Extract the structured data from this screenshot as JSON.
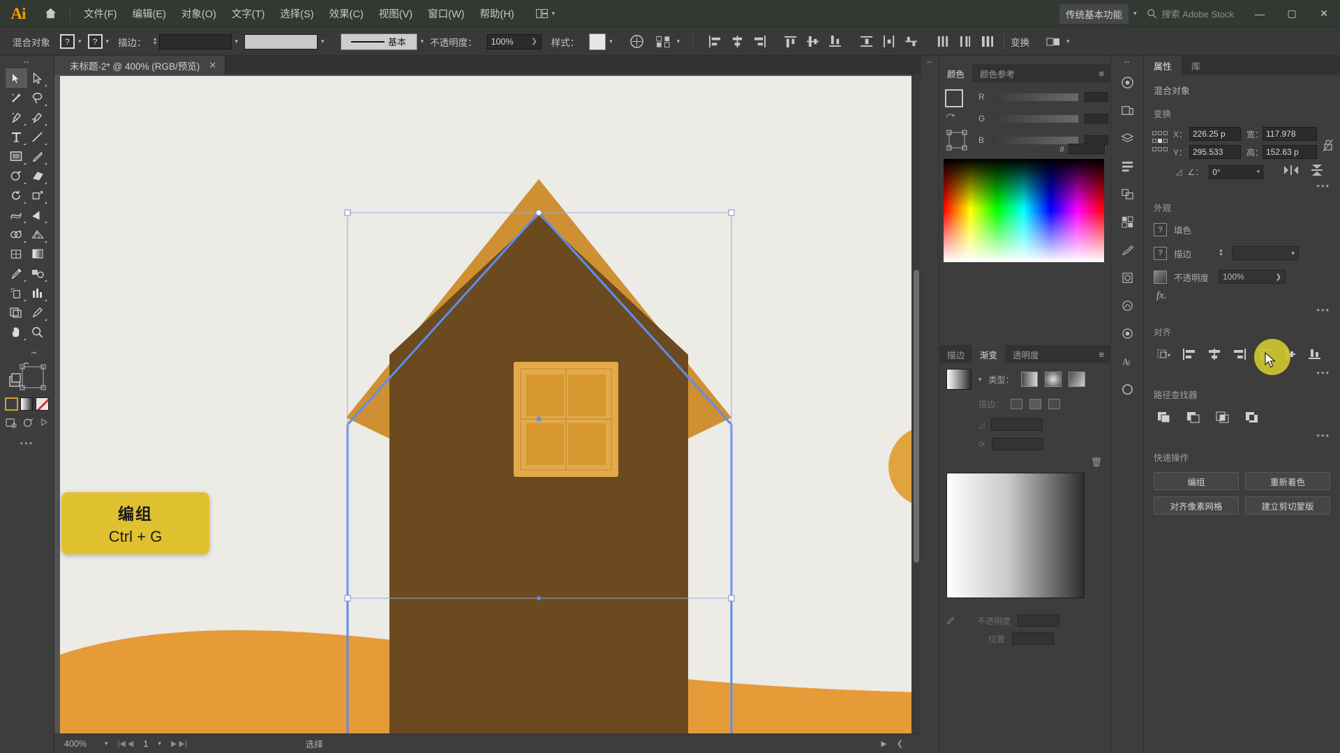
{
  "app": {
    "name": "Adobe Illustrator",
    "logo_text": "Ai"
  },
  "menubar": {
    "items": [
      {
        "label": "文件(F)"
      },
      {
        "label": "编辑(E)"
      },
      {
        "label": "对象(O)"
      },
      {
        "label": "文字(T)"
      },
      {
        "label": "选择(S)"
      },
      {
        "label": "效果(C)"
      },
      {
        "label": "视图(V)"
      },
      {
        "label": "窗口(W)"
      },
      {
        "label": "帮助(H)"
      }
    ],
    "workspace": "传统基本功能",
    "search_placeholder": "搜索 Adobe Stock",
    "window_controls": {
      "minimize": "—",
      "maximize": "▢",
      "close": "✕"
    }
  },
  "controlbar": {
    "object_label": "混合对象",
    "fill_value": "?",
    "stroke_value": "?",
    "stroke_label": "描边：",
    "stroke_weight": "",
    "brush_label": "基本",
    "opacity_label": "不透明度：",
    "opacity_value": "100%",
    "style_label": "样式：",
    "transform_label": "变换"
  },
  "toolbar": {
    "tools": [
      {
        "name": "selection-tool",
        "glyph": "selection",
        "selected": true
      },
      {
        "name": "direct-selection-tool",
        "glyph": "direct-selection",
        "selected": false
      },
      {
        "name": "magic-wand-tool",
        "glyph": "magic-wand",
        "selected": false
      },
      {
        "name": "lasso-tool",
        "glyph": "lasso",
        "selected": false
      },
      {
        "name": "pen-tool",
        "glyph": "pen",
        "selected": false
      },
      {
        "name": "curvature-tool",
        "glyph": "curvature",
        "selected": false
      },
      {
        "name": "type-tool",
        "glyph": "type",
        "selected": false
      },
      {
        "name": "line-segment-tool",
        "glyph": "line",
        "selected": false
      },
      {
        "name": "rectangle-tool",
        "glyph": "rectangle",
        "selected": false
      },
      {
        "name": "paintbrush-tool",
        "glyph": "paintbrush",
        "selected": false
      },
      {
        "name": "shaper-tool",
        "glyph": "shaper",
        "selected": false
      },
      {
        "name": "eraser-tool",
        "glyph": "eraser",
        "selected": false
      },
      {
        "name": "rotate-tool",
        "glyph": "rotate",
        "selected": false
      },
      {
        "name": "scale-tool",
        "glyph": "scale",
        "selected": false
      },
      {
        "name": "width-tool",
        "glyph": "width",
        "selected": false
      },
      {
        "name": "free-transform-tool",
        "glyph": "free-transform",
        "selected": false
      },
      {
        "name": "shape-builder-tool",
        "glyph": "shape-builder",
        "selected": false
      },
      {
        "name": "perspective-grid-tool",
        "glyph": "perspective",
        "selected": false
      },
      {
        "name": "mesh-tool",
        "glyph": "mesh",
        "selected": false
      },
      {
        "name": "gradient-tool",
        "glyph": "gradient",
        "selected": false
      },
      {
        "name": "eyedropper-tool",
        "glyph": "eyedropper",
        "selected": false
      },
      {
        "name": "blend-tool",
        "glyph": "blend",
        "selected": false
      },
      {
        "name": "symbol-sprayer-tool",
        "glyph": "symbol-sprayer",
        "selected": false
      },
      {
        "name": "column-graph-tool",
        "glyph": "column-graph",
        "selected": false
      },
      {
        "name": "artboard-tool",
        "glyph": "artboard",
        "selected": false
      },
      {
        "name": "slice-tool",
        "glyph": "slice",
        "selected": false
      },
      {
        "name": "hand-tool",
        "glyph": "hand",
        "selected": false
      },
      {
        "name": "zoom-tool",
        "glyph": "zoom",
        "selected": false
      }
    ],
    "color_controls": [
      "fill-swatch",
      "gradient-swatch",
      "none-swatch"
    ]
  },
  "document": {
    "tab_title": "未标题-2* @ 400% (RGB/预览)",
    "close_label": "✕"
  },
  "statusbar": {
    "zoom": "400%",
    "page": "1",
    "tool": "选择"
  },
  "color_panel": {
    "tabs": [
      {
        "label": "颜色",
        "active": true
      },
      {
        "label": "颜色参考",
        "active": false
      }
    ],
    "channels": [
      {
        "label": "R",
        "value": ""
      },
      {
        "label": "G",
        "value": ""
      },
      {
        "label": "B",
        "value": ""
      }
    ],
    "hex_label": "#",
    "hex_value": ""
  },
  "gradient_panel": {
    "tabs": [
      {
        "label": "描边",
        "active": false
      },
      {
        "label": "渐变",
        "active": true
      },
      {
        "label": "透明度",
        "active": false
      }
    ],
    "type_label": "类型：",
    "stroke_label": "描边：",
    "angle_label": "",
    "opacity_label": "不透明度",
    "location_label": "位置"
  },
  "properties": {
    "tabs": [
      {
        "label": "属性",
        "active": true
      },
      {
        "label": "库",
        "active": false
      }
    ],
    "object_type": "混合对象",
    "transform": {
      "title": "变换",
      "x_label": "X：",
      "x_value": "226.25 p",
      "y_label": "Y：",
      "y_value": "295.533",
      "w_label": "宽：",
      "w_value": "117.978",
      "h_label": "高：",
      "h_value": "152.63 p",
      "angle_label": "∠：",
      "angle_value": "0°"
    },
    "appearance": {
      "title": "外观",
      "fill_label": "填色",
      "stroke_label": "描边",
      "opacity_label": "不透明度",
      "opacity_value": "100%",
      "fx_label": "fx."
    },
    "align": {
      "title": "对齐"
    },
    "pathfinder": {
      "title": "路径查找器"
    },
    "quick_actions": {
      "title": "快速操作",
      "buttons": [
        {
          "label": "编组"
        },
        {
          "label": "重新着色"
        },
        {
          "label": "对齐像素网格"
        },
        {
          "label": "建立剪切蒙版"
        }
      ]
    }
  },
  "callout": {
    "line1": "编组",
    "line2": "Ctrl + G",
    "bg_color": "#e0c230"
  },
  "artwork": {
    "colors": {
      "wall": "#6b4a1f",
      "roof": "#cf9033",
      "window_frame": "#e3a94a",
      "window_pane": "#d6982f",
      "ground": "#e49b38",
      "artboard_bg": "#ecebe6",
      "selection_blue": "#5b8ef0"
    },
    "description": "house illustration with gable roof, four-pane window, ground hill"
  }
}
